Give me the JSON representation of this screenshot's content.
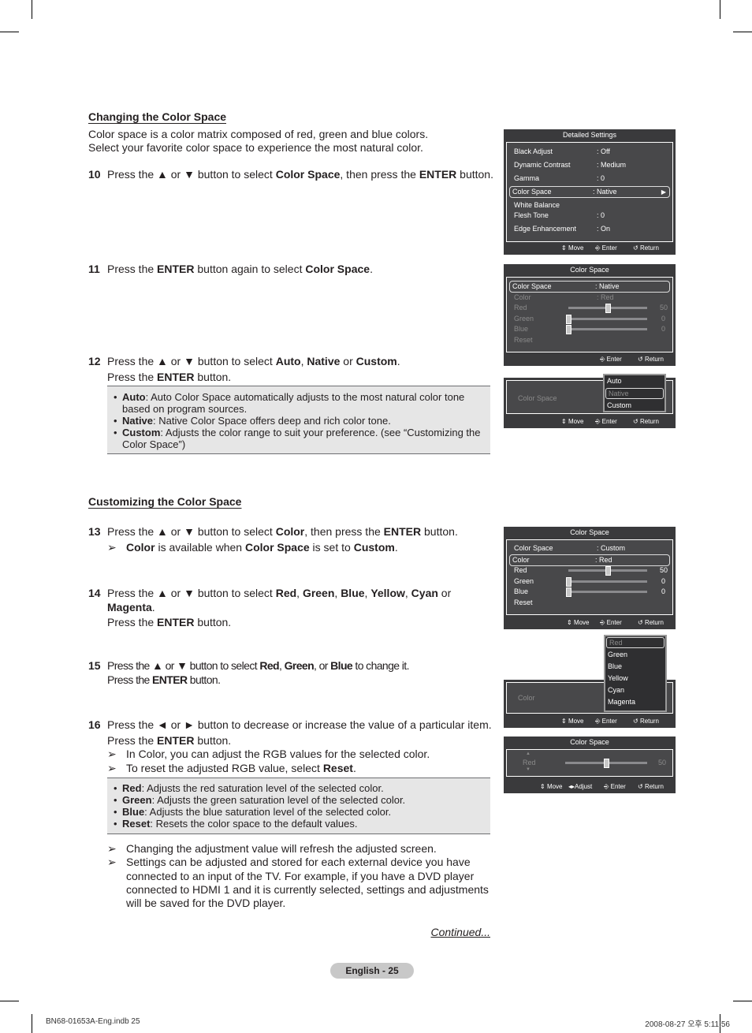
{
  "crop_marks": true,
  "section1": {
    "heading": "Changing the Color Space",
    "intro": [
      "Color space is a color matrix composed of red, green and blue colors.",
      "Select your favorite color space to experience the most natural color."
    ]
  },
  "steps": {
    "s10": {
      "num": "10",
      "parts": [
        "Press the ▲ or ▼ button to select ",
        "Color Space",
        ", then press the ",
        "ENTER",
        " button."
      ]
    },
    "s11": {
      "num": "11",
      "parts": [
        "Press the ",
        "ENTER",
        " button again to select ",
        "Color Space",
        "."
      ]
    },
    "s12": {
      "num": "12",
      "line1": [
        "Press the ▲ or ▼ button to select ",
        "Auto",
        ", ",
        "Native",
        " or ",
        "Custom",
        "."
      ],
      "line2": [
        "Press the ",
        "ENTER",
        " button."
      ]
    },
    "s13": {
      "num": "13",
      "line1": [
        "Press the ▲ or ▼ button to select ",
        "Color",
        ", then press the ",
        "ENTER",
        " button."
      ],
      "note": [
        "Color",
        " is available when ",
        "Color Space",
        " is set to ",
        "Custom",
        "."
      ]
    },
    "s14": {
      "num": "14",
      "line1": [
        "Press the ▲ or ▼ button to select ",
        "Red",
        ", ",
        "Green",
        ", ",
        "Blue",
        ", ",
        "Yellow",
        ", ",
        "Cyan",
        " or"
      ],
      "line2": [
        "Magenta",
        "."
      ],
      "line3": [
        "Press the ",
        "ENTER",
        " button."
      ]
    },
    "s15": {
      "num": "15",
      "line1": [
        "Press the ▲ or ▼ button to select ",
        "Red",
        ", ",
        "Green",
        ", or ",
        "Blue",
        " to change it."
      ],
      "line2": [
        "Press the ",
        "ENTER",
        " button."
      ]
    },
    "s16": {
      "num": "16",
      "line1": "Press the ◄ or ► button to decrease or increase the value of a particular item.",
      "line2": [
        "Press the ",
        "ENTER",
        " button."
      ],
      "note1": "In Color, you can adjust the RGB values for the selected color.",
      "note2": [
        "To reset the adjusted RGB value, select ",
        "Reset",
        "."
      ]
    }
  },
  "arrow_glyph": "➢",
  "bullet_glyph": "•",
  "box1": [
    {
      "term": "Auto",
      "text": ": Auto Color Space automatically adjusts to the most natural color tone",
      "cont": "based on program sources."
    },
    {
      "term": "Native",
      "text": ": Native Color Space offers deep and rich color tone."
    },
    {
      "term": "Custom",
      "text": ": Adjusts the color range to suit your preference. (see “Customizing the",
      "cont": "Color Space”)"
    }
  ],
  "section2": {
    "heading": "Customizing the Color Space"
  },
  "box2": [
    {
      "term": "Red",
      "text": ": Adjusts the red saturation level of the selected color."
    },
    {
      "term": "Green",
      "text": ": Adjusts the green saturation level of the selected color."
    },
    {
      "term": "Blue",
      "text": ": Adjusts the blue saturation level of the selected color."
    },
    {
      "term": "Reset",
      "text": ": Resets the color space to the default values."
    }
  ],
  "end_notes": {
    "n1": "Changing the adjustment value will refresh the adjusted screen.",
    "n2": [
      "Settings can be adjusted and stored for each external device you have",
      "connected to an input of the TV. For example, if you have a DVD player",
      "connected to HDMI 1 and it is currently selected, settings and adjustments",
      "will be saved for the DVD player."
    ]
  },
  "continued": "Continued...",
  "page_label": "English - 25",
  "footer": {
    "file": "BN68-01653A-Eng.indb   25",
    "date": "2008-08-27   오후 5:11:56"
  },
  "osd_footer": {
    "move": "Move",
    "adjust": "Adjust",
    "enter": "Enter",
    "return": "Return"
  },
  "osd1": {
    "title": "Detailed Settings",
    "rows": [
      {
        "label": "Black Adjust",
        "value": ": Off"
      },
      {
        "label": "Dynamic Contrast",
        "value": ": Medium"
      },
      {
        "label": "Gamma",
        "value": ": 0"
      },
      {
        "label": "Color Space",
        "value": ": Native"
      },
      {
        "label": "White Balance",
        "value": ""
      },
      {
        "label": "Flesh Tone",
        "value": ": 0"
      },
      {
        "label": "Edge Enhancement",
        "value": ": On"
      }
    ]
  },
  "osd2": {
    "title": "Color Space",
    "color_space_label": "Color Space",
    "color_space_value": ": Native",
    "color_label": "Color",
    "color_value": ": Red",
    "sliders": [
      {
        "label": "Red",
        "value": 50
      },
      {
        "label": "Green",
        "value": 0
      },
      {
        "label": "Blue",
        "value": 0
      }
    ],
    "reset_label": "Reset"
  },
  "osd3": {
    "label": "Color Space",
    "options": [
      "Auto",
      "Native",
      "Custom"
    ],
    "selected": "Native"
  },
  "osd4": {
    "title": "Color Space",
    "color_space_label": "Color Space",
    "color_space_value": ": Custom",
    "color_label": "Color",
    "color_value": ": Red",
    "sliders": [
      {
        "label": "Red",
        "value": 50
      },
      {
        "label": "Green",
        "value": 0
      },
      {
        "label": "Blue",
        "value": 0
      }
    ],
    "reset_label": "Reset"
  },
  "osd5": {
    "label": "Color",
    "options": [
      "Red",
      "Green",
      "Blue",
      "Yellow",
      "Cyan",
      "Magenta"
    ],
    "selected": "Red"
  },
  "osd6": {
    "title": "Color Space",
    "label": "Red",
    "value": 50,
    "max": 100
  }
}
